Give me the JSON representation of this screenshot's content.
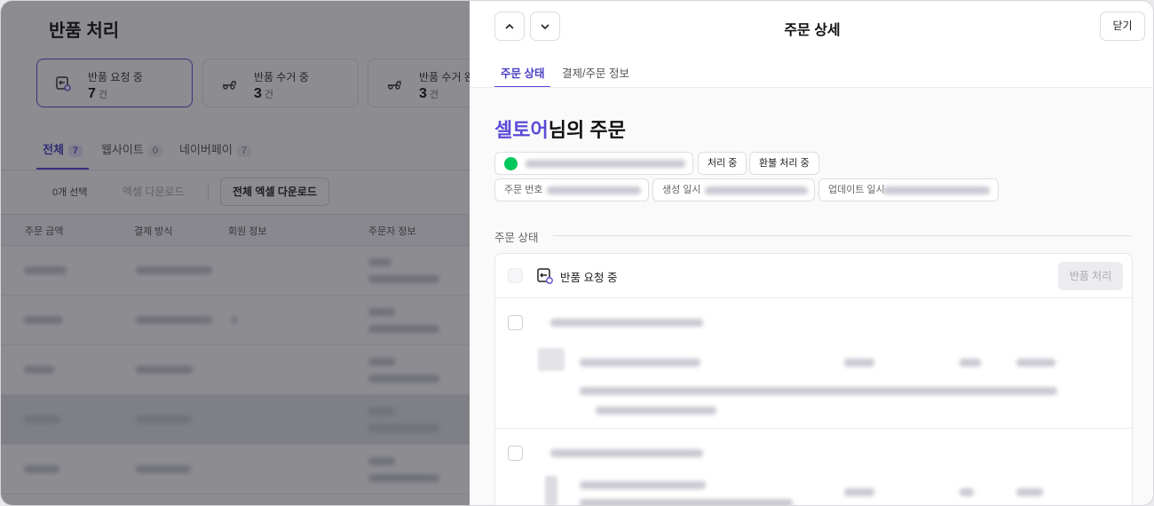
{
  "page": {
    "title": "반품 처리",
    "status_cards": [
      {
        "label": "반품 요청 중",
        "count": "7",
        "unit": "건",
        "icon": "return-request-icon"
      },
      {
        "label": "반품 수거 중",
        "count": "3",
        "unit": "건",
        "icon": "truck-pickup-icon"
      },
      {
        "label": "반품 수거 완",
        "count": "3",
        "unit": "건",
        "icon": "truck-done-icon"
      }
    ],
    "tabs": [
      {
        "label": "전체",
        "count": "7"
      },
      {
        "label": "웹사이트",
        "count": "0"
      },
      {
        "label": "네이버페이",
        "count": "7"
      }
    ],
    "selected_count": "0개 선택",
    "excel_download": "엑셀 다운로드",
    "excel_download_all": "전체 엑셀 다운로드",
    "table_headers": [
      "주문 금액",
      "결제 방식",
      "회원 정보",
      "주문자 정보"
    ]
  },
  "panel": {
    "title": "주문 상세",
    "close_label": "닫기",
    "tabs": [
      "주문 상태",
      "결제/주문 정보"
    ],
    "customer_name": "셀토어",
    "order_title_suffix": "님의 주문",
    "status_chips": [
      "처리 중",
      "환불 처리 중"
    ],
    "meta_labels": [
      "주문 번호",
      "생성 일시",
      "업데이트 일시"
    ],
    "section_label": "주문 상태",
    "card_title": "반품 요청 중",
    "process_button": "반품 처리",
    "colors": {
      "accent": "#5b4bd6",
      "naverpay": "#03c75a"
    }
  }
}
